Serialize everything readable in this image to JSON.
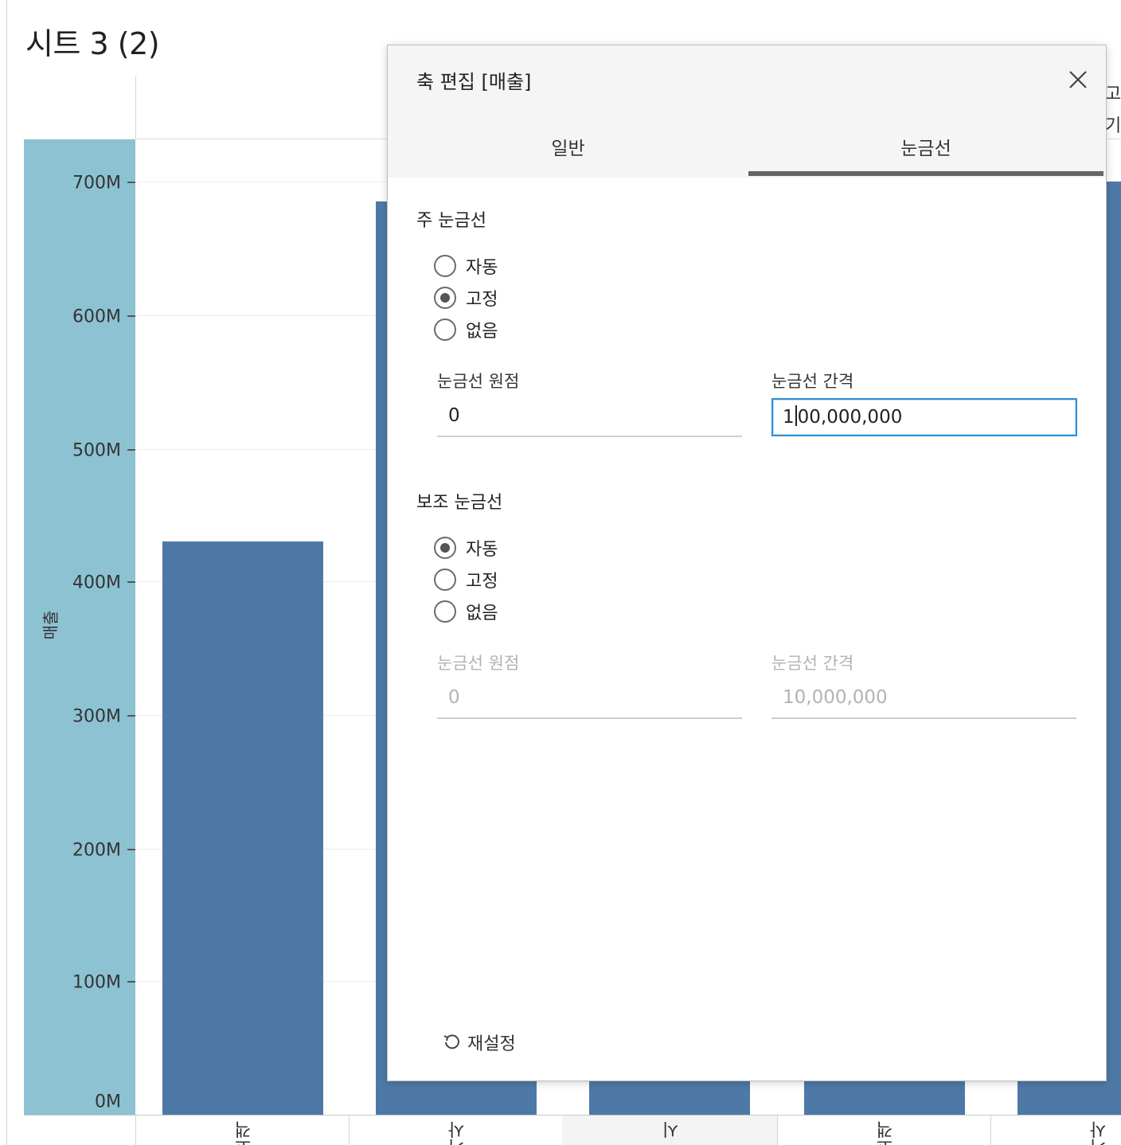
{
  "worksheet": {
    "title": "시트 3 (2)",
    "axis_title": "매출",
    "bar_color": "#4e79a7",
    "axis_band_color": "#8dc2d2",
    "peek_header": [
      "고객",
      "기"
    ],
    "category_labels_partial": [
      "고객",
      "기사",
      "시",
      "고객",
      "기사"
    ]
  },
  "chart_data": {
    "type": "bar",
    "ylabel": "매출",
    "ylim": [
      0,
      700000000
    ],
    "y_ticks": [
      "700M",
      "600M",
      "500M",
      "400M",
      "300M",
      "200M",
      "100M",
      "0M"
    ],
    "values_visible": [
      430000000,
      685000000,
      700000000
    ]
  },
  "dialog": {
    "title": "축 편집 [매출]",
    "tabs": [
      {
        "label": "일반",
        "active": false
      },
      {
        "label": "눈금선",
        "active": true
      }
    ],
    "major": {
      "title": "주 눈금선",
      "options": [
        {
          "label": "자동",
          "checked": false
        },
        {
          "label": "고정",
          "checked": true
        },
        {
          "label": "없음",
          "checked": false
        }
      ],
      "origin_label": "눈금선 원점",
      "origin_value": "0",
      "interval_label": "눈금선 간격",
      "interval_value_before_caret": "1",
      "interval_value_after_caret": "00,000,000"
    },
    "minor": {
      "title": "보조 눈금선",
      "options": [
        {
          "label": "자동",
          "checked": true
        },
        {
          "label": "고정",
          "checked": false
        },
        {
          "label": "없음",
          "checked": false
        }
      ],
      "origin_label": "눈금선 원점",
      "origin_value": "0",
      "interval_label": "눈금선 간격",
      "interval_value": "10,000,000"
    },
    "reset_label": "재설정"
  }
}
